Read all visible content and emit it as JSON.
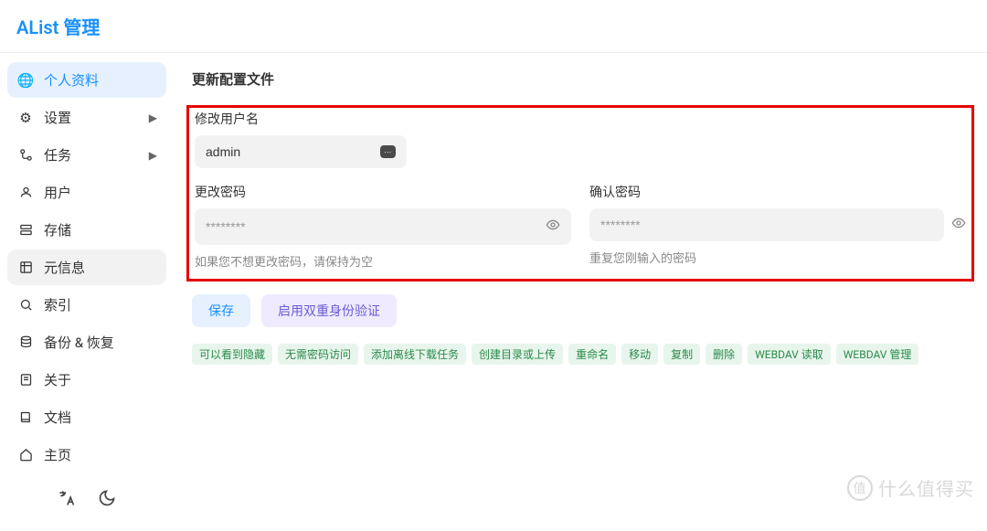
{
  "header": {
    "title": "AList 管理"
  },
  "sidebar": {
    "items": [
      {
        "label": "个人资料"
      },
      {
        "label": "设置"
      },
      {
        "label": "任务"
      },
      {
        "label": "用户"
      },
      {
        "label": "存储"
      },
      {
        "label": "元信息"
      },
      {
        "label": "索引"
      },
      {
        "label": "备份 & 恢复"
      },
      {
        "label": "关于"
      },
      {
        "label": "文档"
      },
      {
        "label": "主页"
      }
    ]
  },
  "main": {
    "title": "更新配置文件",
    "username": {
      "label": "修改用户名",
      "value": "admin"
    },
    "password": {
      "label": "更改密码",
      "placeholder": "********",
      "hint": "如果您不想更改密码，请保持为空"
    },
    "confirm_password": {
      "label": "确认密码",
      "placeholder": "********",
      "hint": "重复您刚输入的密码"
    },
    "buttons": {
      "save": "保存",
      "enable_2fa": "启用双重身份验证"
    },
    "tags": [
      "可以看到隐藏",
      "无需密码访问",
      "添加离线下载任务",
      "创建目录或上传",
      "重命名",
      "移动",
      "复制",
      "删除",
      "WEBDAV 读取",
      "WEBDAV 管理"
    ]
  },
  "watermark": "什么值得买"
}
